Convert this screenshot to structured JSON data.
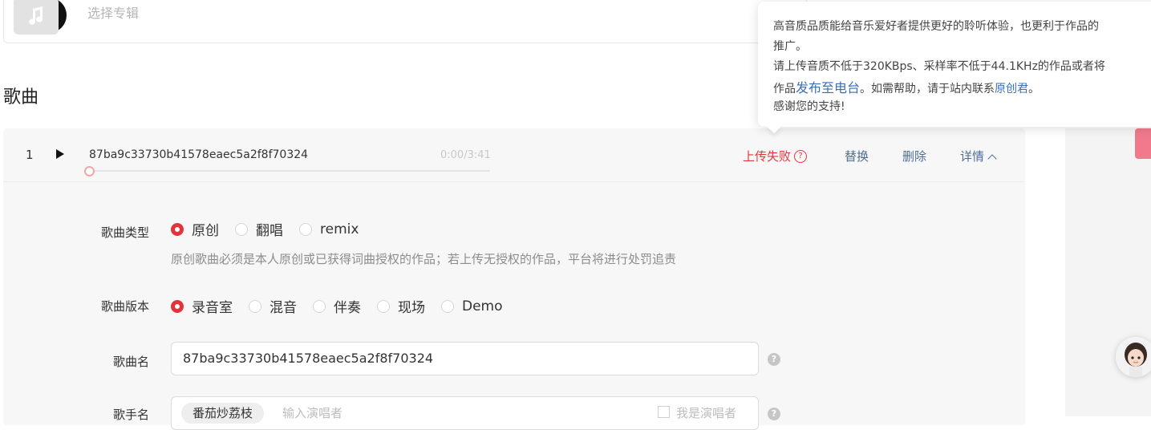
{
  "album": {
    "placeholder": "选择专辑"
  },
  "section": {
    "title": "歌曲"
  },
  "song": {
    "index": "1",
    "filename": "87ba9c33730b41578eaec5a2f8f70324",
    "duration": "0:00/3:41",
    "status": "上传失败",
    "actions": {
      "replace": "替换",
      "delete": "删除",
      "details": "详情"
    }
  },
  "form": {
    "type": {
      "label": "歌曲类型",
      "options": [
        "原创",
        "翻唱",
        "remix"
      ],
      "selected": "原创",
      "hint": "原创歌曲必须是本人原创或已获得词曲授权的作品；若上传无授权的作品，平台将进行处罚追责"
    },
    "version": {
      "label": "歌曲版本",
      "options": [
        "录音室",
        "混音",
        "伴奏",
        "现场",
        "Demo"
      ],
      "selected": "录音室"
    },
    "name": {
      "label": "歌曲名",
      "value": "87ba9c33730b41578eaec5a2f8f70324"
    },
    "singer": {
      "label": "歌手名",
      "tag": "番茄炒荔枝",
      "placeholder": "输入演唱者",
      "self_label": "我是演唱者"
    }
  },
  "tooltip": {
    "line1": "高音质品质能给音乐爱好者提供更好的聆听体验，也更利于作品的",
    "line2": "推广。",
    "line3": "请上传音质不低于320KBps、采样率不低于44.1KHz的作品或者将",
    "line4_a": "作品",
    "line4_link": "发布至电台",
    "line4_b": "。如需帮助，请于站内联系",
    "line4_link2": "原创君",
    "line4_c": "。",
    "line5": "感谢您的支持!"
  },
  "colors": {
    "accent": "#e3343d",
    "link": "#4f6d96"
  }
}
